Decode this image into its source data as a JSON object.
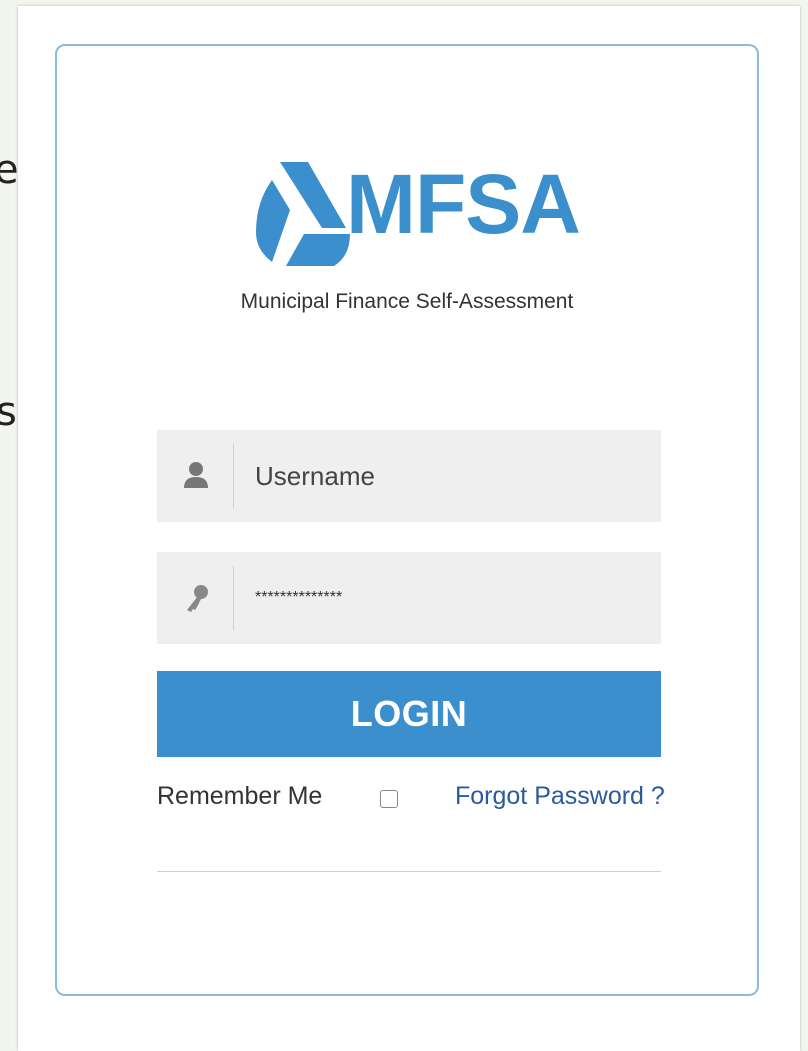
{
  "background_fragments": [
    "es",
    "s,"
  ],
  "brand": {
    "name": "MFSA",
    "subtitle": "Municipal Finance Self-Assessment",
    "color": "#3a8fcc"
  },
  "login_form": {
    "username": {
      "placeholder": "Username",
      "value": "",
      "icon": "user-icon"
    },
    "password": {
      "value": "**************",
      "icon": "key-icon"
    },
    "login_label": "LOGIN",
    "remember_label": "Remember Me",
    "remember_checked": false,
    "forgot_label": "Forgot Password ?"
  },
  "colors": {
    "accent": "#3a8fcc",
    "link": "#2a5a9e",
    "card_border": "#8fb9dc",
    "field_bg": "#efefef"
  }
}
